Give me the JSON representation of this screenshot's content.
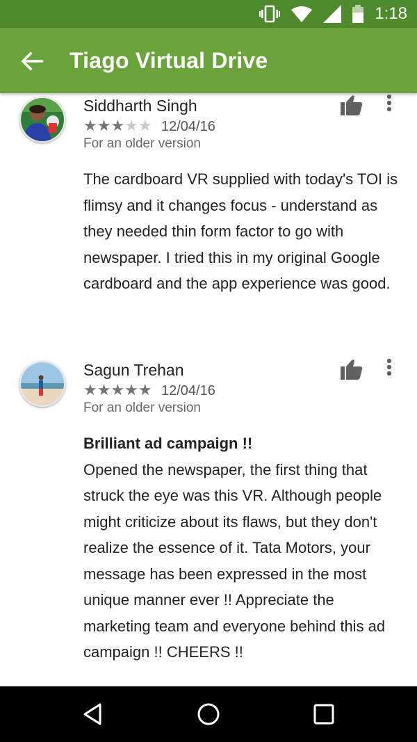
{
  "status_bar": {
    "time": "1:18",
    "icons": [
      "vibrate-icon",
      "wifi-icon",
      "signal-icon",
      "battery-icon"
    ]
  },
  "app_bar": {
    "title": "Tiago Virtual Drive",
    "back_icon": "back-arrow-icon",
    "color": "#69a33a"
  },
  "reviews": [
    {
      "author": "Siddharth Singh",
      "rating": 3,
      "max_rating": 5,
      "stars_on": "★★★",
      "stars_off": "★★",
      "date": "12/04/16",
      "version_note": "For an older version",
      "title": "",
      "text": "The cardboard VR supplied with today's TOI is flimsy and it changes focus - understand as they needed thin form factor to go with newspaper. I tried this in my original Google cardboard and the app experience was good."
    },
    {
      "author": "Sagun Trehan",
      "rating": 5,
      "max_rating": 5,
      "stars_on": "★★★★★",
      "stars_off": "",
      "date": "12/04/16",
      "version_note": "For an older version",
      "title": "Brilliant ad campaign !!",
      "text": "Opened the newspaper, the first thing that struck the eye was this VR. Although people might criticize about its flaws, but they don't realize the essence of it. Tata Motors, your message has been expressed in the most unique manner ever !! Appreciate the marketing team and everyone behind this ad campaign !! CHEERS !!"
    }
  ],
  "nav_bar": {
    "buttons": [
      "back-triangle-icon",
      "home-circle-icon",
      "recents-square-icon"
    ]
  }
}
